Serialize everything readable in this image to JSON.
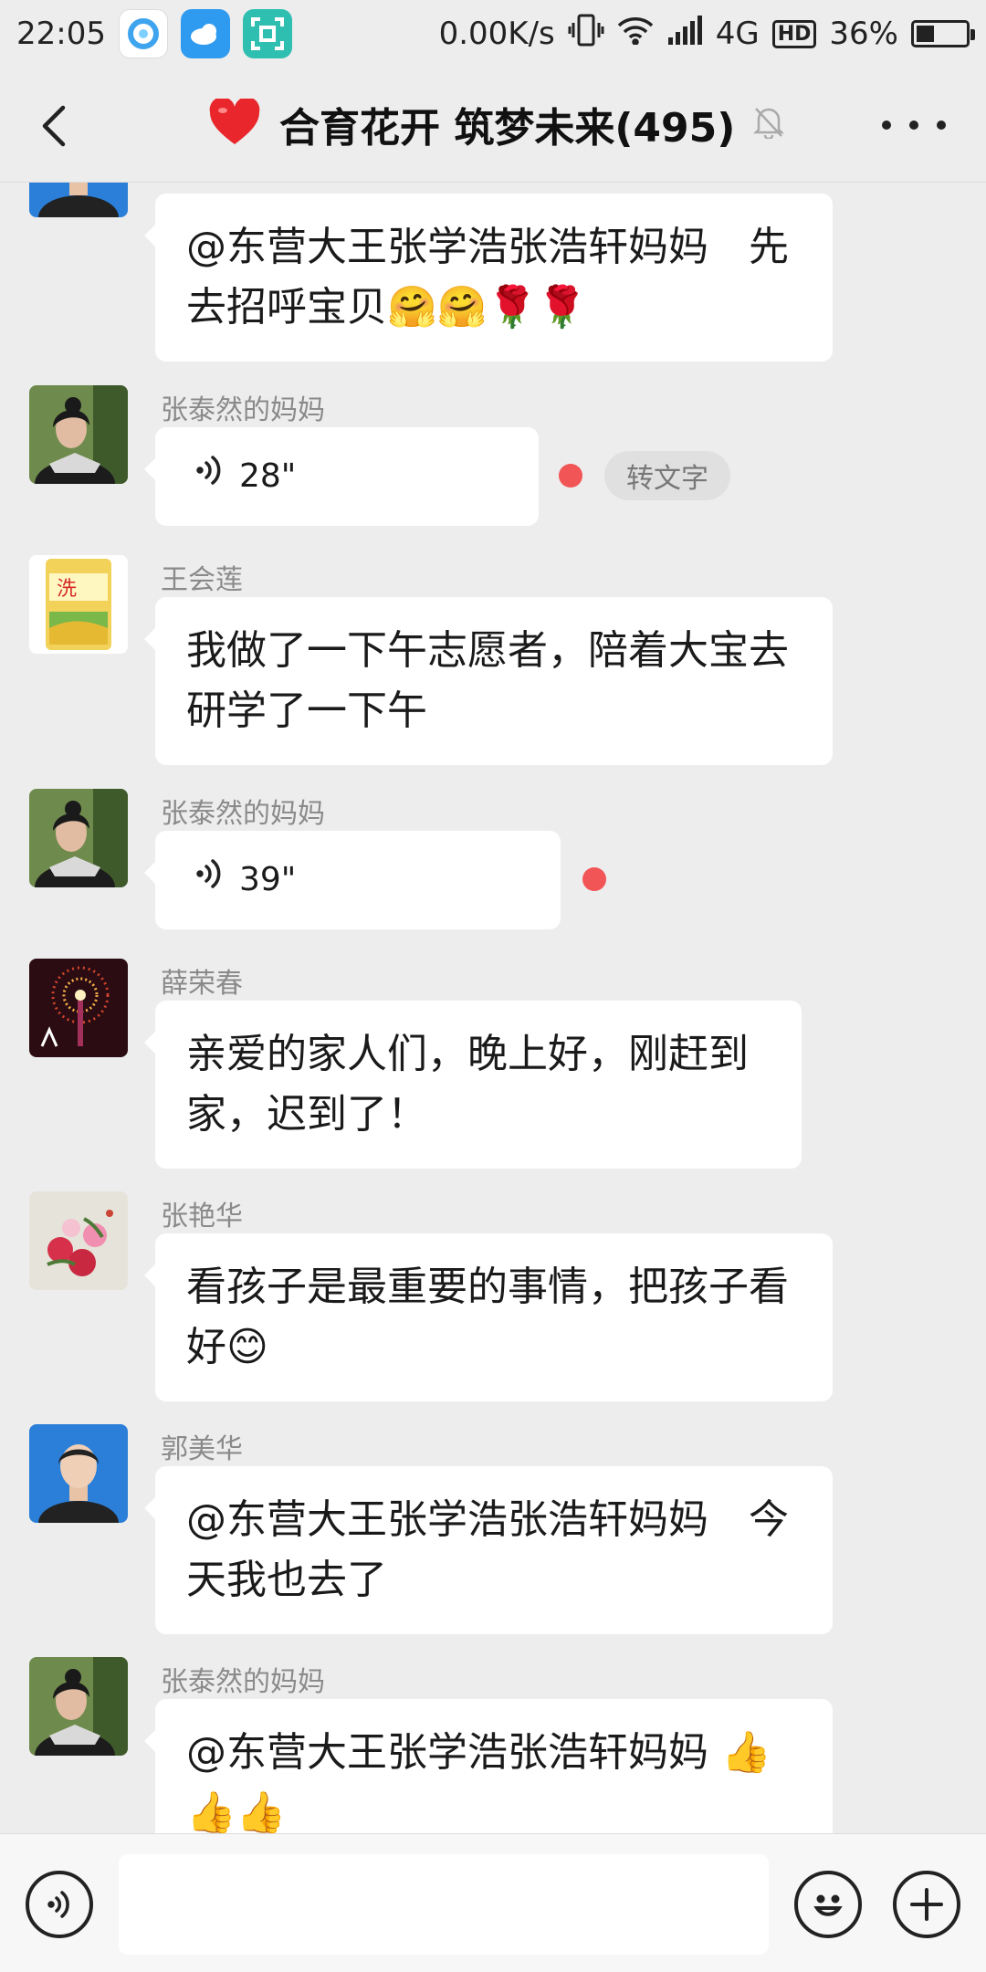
{
  "status": {
    "time": "22:05",
    "net_speed": "0.00K/s",
    "network": "4G",
    "hd": "HD",
    "battery_percent": "36%",
    "battery_level": 0.36
  },
  "header": {
    "title": "合育花开 筑梦未来(495)"
  },
  "messages": [
    {
      "sender": "",
      "text": "@东营大王张学浩张浩轩妈妈　先去招呼宝贝🤗🤗🌹🌹"
    },
    {
      "sender": "张泰然的妈妈",
      "voice": "28\"",
      "to_text": "转文字"
    },
    {
      "sender": "王会莲",
      "text": "我做了一下午志愿者，陪着大宝去研学了一下午"
    },
    {
      "sender": "张泰然的妈妈",
      "voice": "39\""
    },
    {
      "sender": "薛荣春",
      "text": "亲爱的家人们，晚上好，刚赶到家，迟到了！"
    },
    {
      "sender": "张艳华",
      "text": "看孩子是最重要的事情，把孩子看好😊"
    },
    {
      "sender": "郭美华",
      "text": "@东营大王张学浩张浩轩妈妈　今天我也去了"
    },
    {
      "sender": "张泰然的妈妈",
      "text": "@东营大王张学浩张浩轩妈妈 👍👍👍"
    }
  ],
  "input": {
    "placeholder": ""
  },
  "colors": {
    "background": "#ededed",
    "bubble": "#ffffff",
    "unread_dot": "#f25555"
  }
}
